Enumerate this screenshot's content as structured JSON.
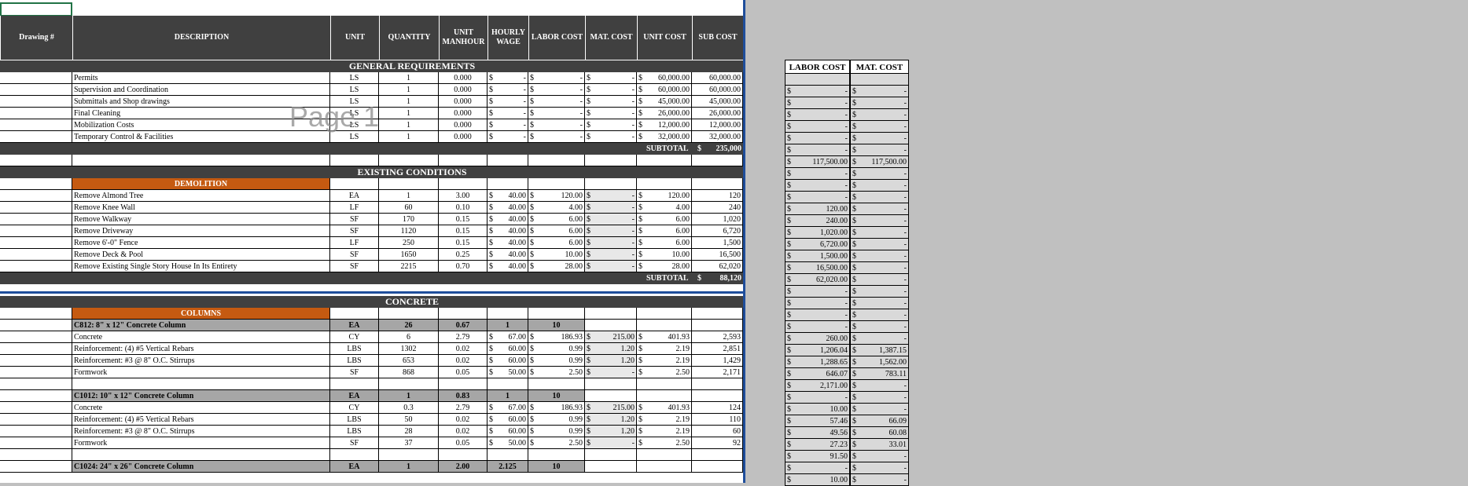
{
  "columns": [
    "Drawing #",
    "DESCRIPTION",
    "UNIT",
    "QUANTITY",
    "UNIT MANHOUR",
    "HOURLY WAGE",
    "LABOR COST",
    "MAT. COST",
    "UNIT COST",
    "SUB COST"
  ],
  "watermark": "Page 1",
  "currency": "$",
  "sections": [
    {
      "title": "GENERAL REQUIREMENTS"
    },
    {
      "title": "EXISTING CONDITIONS",
      "group": "DEMOLITION"
    },
    {
      "title": "CONCRETE",
      "group": "COLUMNS"
    }
  ],
  "general": [
    {
      "desc": "Permits",
      "unit": "LS",
      "qty": "1",
      "manhour": "0.000",
      "wage": "-",
      "labor": "-",
      "mat": "-",
      "unit_cost": "60,000.00",
      "sub": "60,000.00"
    },
    {
      "desc": "Supervision and Coordination",
      "unit": "LS",
      "qty": "1",
      "manhour": "0.000",
      "wage": "-",
      "labor": "-",
      "mat": "-",
      "unit_cost": "60,000.00",
      "sub": "60,000.00"
    },
    {
      "desc": "Submittals and Shop drawings",
      "unit": "LS",
      "qty": "1",
      "manhour": "0.000",
      "wage": "-",
      "labor": "-",
      "mat": "-",
      "unit_cost": "45,000.00",
      "sub": "45,000.00"
    },
    {
      "desc": "Final Cleaning",
      "unit": "LS",
      "qty": "1",
      "manhour": "0.000",
      "wage": "-",
      "labor": "-",
      "mat": "-",
      "unit_cost": "26,000.00",
      "sub": "26,000.00"
    },
    {
      "desc": "Mobilization Costs",
      "unit": "LS",
      "qty": "1",
      "manhour": "0.000",
      "wage": "-",
      "labor": "-",
      "mat": "-",
      "unit_cost": "12,000.00",
      "sub": "12,000.00"
    },
    {
      "desc": "Temporary Control & Facilities",
      "unit": "LS",
      "qty": "1",
      "manhour": "0.000",
      "wage": "-",
      "labor": "-",
      "mat": "-",
      "unit_cost": "32,000.00",
      "sub": "32,000.00"
    }
  ],
  "general_subtotal": {
    "label": "SUBTOTAL",
    "value": "235,000"
  },
  "demolition": [
    {
      "desc": "Remove Almond Tree",
      "unit": "EA",
      "qty": "1",
      "manhour": "3.00",
      "wage": "40.00",
      "labor": "120.00",
      "mat": "-",
      "unit_cost": "120.00",
      "sub": "120"
    },
    {
      "desc": "Remove Knee Wall",
      "unit": "LF",
      "qty": "60",
      "manhour": "0.10",
      "wage": "40.00",
      "labor": "4.00",
      "mat": "-",
      "unit_cost": "4.00",
      "sub": "240"
    },
    {
      "desc": "Remove Walkway",
      "unit": "SF",
      "qty": "170",
      "manhour": "0.15",
      "wage": "40.00",
      "labor": "6.00",
      "mat": "-",
      "unit_cost": "6.00",
      "sub": "1,020"
    },
    {
      "desc": "Remove Driveway",
      "unit": "SF",
      "qty": "1120",
      "manhour": "0.15",
      "wage": "40.00",
      "labor": "6.00",
      "mat": "-",
      "unit_cost": "6.00",
      "sub": "6,720"
    },
    {
      "desc": "Remove 6'-0\" Fence",
      "unit": "LF",
      "qty": "250",
      "manhour": "0.15",
      "wage": "40.00",
      "labor": "6.00",
      "mat": "-",
      "unit_cost": "6.00",
      "sub": "1,500"
    },
    {
      "desc": "Remove Deck & Pool",
      "unit": "SF",
      "qty": "1650",
      "manhour": "0.25",
      "wage": "40.00",
      "labor": "10.00",
      "mat": "-",
      "unit_cost": "10.00",
      "sub": "16,500"
    },
    {
      "desc": "Remove Existing Single Story House In Its Entirety",
      "unit": "SF",
      "qty": "2215",
      "manhour": "0.70",
      "wage": "40.00",
      "labor": "28.00",
      "mat": "-",
      "unit_cost": "28.00",
      "sub": "62,020"
    }
  ],
  "demolition_subtotal": {
    "label": "SUBTOTAL",
    "value": "88,120"
  },
  "columns_c812": {
    "header": {
      "desc": "C812: 8\" x 12\" Concrete Column",
      "unit": "EA",
      "qty": "26",
      "manhour": "0.67",
      "wage": "1",
      "labor": "10"
    },
    "items": [
      {
        "desc": "Concrete",
        "unit": "CY",
        "qty": "6",
        "manhour": "2.79",
        "wage": "67.00",
        "labor": "186.93",
        "mat": "215.00",
        "unit_cost": "401.93",
        "sub": "2,593"
      },
      {
        "desc": "Reinforcement: (4) #5 Vertical Rebars",
        "unit": "LBS",
        "qty": "1302",
        "manhour": "0.02",
        "wage": "60.00",
        "labor": "0.99",
        "mat": "1.20",
        "unit_cost": "2.19",
        "sub": "2,851"
      },
      {
        "desc": "Reinforcement: #3 @ 8\" O.C. Stirrups",
        "unit": "LBS",
        "qty": "653",
        "manhour": "0.02",
        "wage": "60.00",
        "labor": "0.99",
        "mat": "1.20",
        "unit_cost": "2.19",
        "sub": "1,429"
      },
      {
        "desc": "Formwork",
        "unit": "SF",
        "qty": "868",
        "manhour": "0.05",
        "wage": "50.00",
        "labor": "2.50",
        "mat": "-",
        "unit_cost": "2.50",
        "sub": "2,171"
      }
    ]
  },
  "columns_c1012": {
    "header": {
      "desc": "C1012: 10\" x 12\" Concrete Column",
      "unit": "EA",
      "qty": "1",
      "manhour": "0.83",
      "wage": "1",
      "labor": "10"
    },
    "items": [
      {
        "desc": "Concrete",
        "unit": "CY",
        "qty": "0.3",
        "manhour": "2.79",
        "wage": "67.00",
        "labor": "186.93",
        "mat": "215.00",
        "unit_cost": "401.93",
        "sub": "124"
      },
      {
        "desc": "Reinforcement: (4) #5 Vertical Rebars",
        "unit": "LBS",
        "qty": "50",
        "manhour": "0.02",
        "wage": "60.00",
        "labor": "0.99",
        "mat": "1.20",
        "unit_cost": "2.19",
        "sub": "110"
      },
      {
        "desc": "Reinforcement: #3 @ 8\" O.C. Stirrups",
        "unit": "LBS",
        "qty": "28",
        "manhour": "0.02",
        "wage": "60.00",
        "labor": "0.99",
        "mat": "1.20",
        "unit_cost": "2.19",
        "sub": "60"
      },
      {
        "desc": "Formwork",
        "unit": "SF",
        "qty": "37",
        "manhour": "0.05",
        "wage": "50.00",
        "labor": "2.50",
        "mat": "-",
        "unit_cost": "2.50",
        "sub": "92"
      }
    ]
  },
  "columns_c1024": {
    "desc": "C1024: 24\" x 26\" Concrete Column",
    "unit": "EA",
    "qty": "1",
    "manhour": "2.00",
    "wage": "2.125",
    "labor": "10"
  },
  "side_table": {
    "headers": [
      "LABOR COST",
      "MAT. COST"
    ],
    "rows": [
      [
        "",
        ""
      ],
      [
        "-",
        "-"
      ],
      [
        "-",
        "-"
      ],
      [
        "-",
        "-"
      ],
      [
        "-",
        "-"
      ],
      [
        "-",
        "-"
      ],
      [
        "-",
        "-"
      ],
      [
        "117,500.00",
        "117,500.00"
      ],
      [
        "-",
        "-"
      ],
      [
        "-",
        "-"
      ],
      [
        "-",
        "-"
      ],
      [
        "120.00",
        "-"
      ],
      [
        "240.00",
        "-"
      ],
      [
        "1,020.00",
        "-"
      ],
      [
        "6,720.00",
        "-"
      ],
      [
        "1,500.00",
        "-"
      ],
      [
        "16,500.00",
        "-"
      ],
      [
        "62,020.00",
        "-"
      ],
      [
        "-",
        "-"
      ],
      [
        "-",
        "-"
      ],
      [
        "-",
        "-"
      ],
      [
        "-",
        "-"
      ],
      [
        "260.00",
        "-"
      ],
      [
        "1,206.04",
        "1,387.15"
      ],
      [
        "1,288.65",
        "1,562.00"
      ],
      [
        "646.07",
        "783.11"
      ],
      [
        "2,171.00",
        "-"
      ],
      [
        "-",
        "-"
      ],
      [
        "10.00",
        "-"
      ],
      [
        "57.46",
        "66.09"
      ],
      [
        "49.56",
        "60.08"
      ],
      [
        "27.23",
        "33.01"
      ],
      [
        "91.50",
        "-"
      ],
      [
        "-",
        "-"
      ],
      [
        "10.00",
        "-"
      ]
    ]
  }
}
